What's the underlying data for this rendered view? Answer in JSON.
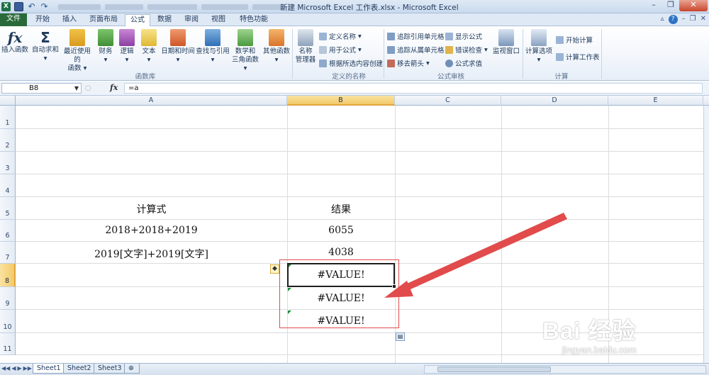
{
  "title_bar": {
    "title": "新建 Microsoft Excel 工作表.xlsx - Microsoft Excel",
    "app_icon": "X"
  },
  "ribbon_tabs": [
    "文件",
    "开始",
    "插入",
    "页面布局",
    "公式",
    "数据",
    "审阅",
    "视图",
    "特色功能"
  ],
  "active_tab": "公式",
  "ribbon": {
    "function_library": {
      "label": "函数库",
      "insert_function": "插入函数",
      "autosum": "自动求和",
      "recent_1": "最近使用的",
      "recent_2": "函数",
      "financial": "财务",
      "logical": "逻辑",
      "text": "文本",
      "datetime": "日期和时间",
      "lookup": "查找与引用",
      "math_1": "数学和",
      "math_2": "三角函数",
      "more": "其他函数"
    },
    "defined_names": {
      "label": "定义的名称",
      "name_manager_1": "名称",
      "name_manager_2": "管理器",
      "define_name": "定义名称",
      "use_in_formula": "用于公式",
      "create_from_selection": "根据所选内容创建"
    },
    "formula_auditing": {
      "label": "公式审核",
      "trace_precedents": "追踪引用单元格",
      "trace_dependents": "追踪从属单元格",
      "remove_arrows": "移去箭头",
      "show_formulas": "显示公式",
      "error_checking": "错误检查",
      "evaluate": "公式求值",
      "watch_window": "监视窗口"
    },
    "calculation": {
      "label": "计算",
      "options": "计算选项",
      "calc_now": "开始计算",
      "calc_sheet": "计算工作表"
    }
  },
  "formula_bar": {
    "name_box": "B8",
    "fx": "fx",
    "formula": "=a"
  },
  "columns": [
    "A",
    "B",
    "C",
    "D",
    "E"
  ],
  "selected_column": "B",
  "rows": [
    "1",
    "2",
    "3",
    "4",
    "5",
    "6",
    "7",
    "8",
    "9",
    "10",
    "11"
  ],
  "selected_row": "8",
  "cells": {
    "A5": "计算式",
    "B5": "结果",
    "A6": "2018+2018+2019",
    "B6": "6055",
    "A7": "2019[文字]+2019[文字]",
    "B7": "4038",
    "B8": "#VALUE!",
    "B9": "#VALUE!",
    "B10": "#VALUE!"
  },
  "sheet_tabs": [
    "Sheet1",
    "Sheet2",
    "Sheet3"
  ],
  "active_sheet": "Sheet1",
  "watermark": {
    "main": "Bai 经验",
    "sub": "jingyan.baidu.com"
  },
  "colors": {
    "accent_red": "#e14b4b",
    "error_green": "#1f8a3c",
    "selection_header": "#f3c96a"
  }
}
